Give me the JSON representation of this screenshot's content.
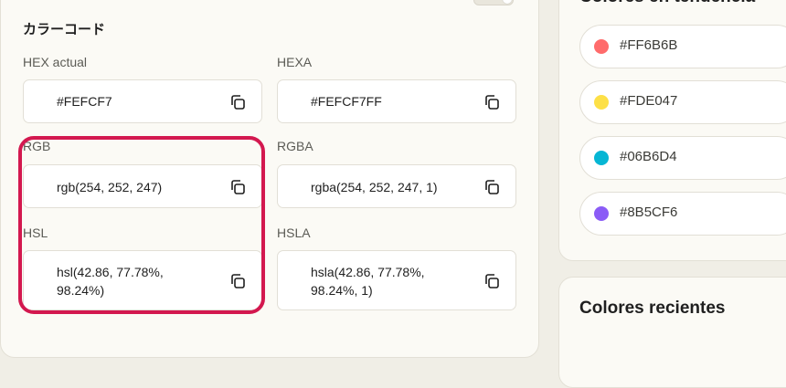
{
  "section": {
    "title": "カラーコード"
  },
  "fields": {
    "hex_actual": {
      "label": "HEX actual",
      "value": "#FEFCF7"
    },
    "hexa": {
      "label": "HEXA",
      "value": "#FEFCF7FF"
    },
    "rgb": {
      "label": "RGB",
      "value": "rgb(254, 252, 247)"
    },
    "rgba": {
      "label": "RGBA",
      "value": "rgba(254, 252, 247, 1)"
    },
    "hsl": {
      "label": "HSL",
      "value_line1": "hsl(42.86, 77.78%,",
      "value_line2": "98.24%)"
    },
    "hsla": {
      "label": "HSLA",
      "value_line1": "hsla(42.86, 77.78%,",
      "value_line2": "98.24%, 1)"
    }
  },
  "copy_icon": "copy-icon",
  "highlight_color": "#d3184f",
  "trending": {
    "title": "Colores en tendencia",
    "items": [
      {
        "hex": "#FF6B6B",
        "color": "#FF6B6B"
      },
      {
        "hex": "#FDE047",
        "color": "#FDE047"
      },
      {
        "hex": "#06B6D4",
        "color": "#06B6D4"
      },
      {
        "hex": "#8B5CF6",
        "color": "#8B5CF6"
      }
    ]
  },
  "recent": {
    "title": "Colores recientes"
  }
}
